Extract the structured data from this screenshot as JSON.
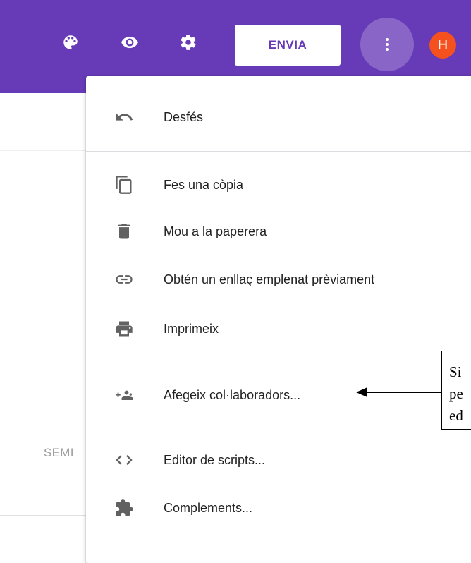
{
  "toolbar": {
    "palette_icon": "palette-icon",
    "preview_icon": "eye-icon",
    "settings_icon": "gear-icon",
    "send_label": "ENVIA",
    "more_icon": "more-vert-icon",
    "avatar_initial": "H",
    "avatar_color": "#f4511e",
    "bar_color": "#673ab7"
  },
  "background": {
    "partial_text": "SEMI"
  },
  "menu": {
    "items": [
      {
        "label": "Desfés",
        "icon": "undo-icon"
      },
      {
        "label": "Fes una còpia",
        "icon": "copy-icon"
      },
      {
        "label": "Mou a la paperera",
        "icon": "trash-icon"
      },
      {
        "label": "Obtén un enllaç emplenat prèviament",
        "icon": "link-icon"
      },
      {
        "label": "Imprimeix",
        "icon": "print-icon"
      },
      {
        "label": "Afegeix col·laboradors...",
        "icon": "add-people-icon"
      },
      {
        "label": "Editor de scripts...",
        "icon": "code-icon"
      },
      {
        "label": "Complements...",
        "icon": "puzzle-icon"
      }
    ]
  },
  "annotation": {
    "line1": "Si",
    "line2": "pe",
    "line3": "ed"
  }
}
